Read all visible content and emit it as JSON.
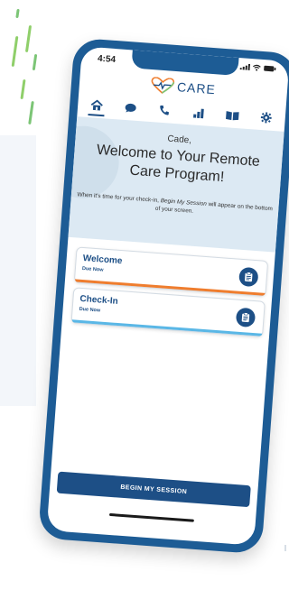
{
  "status": {
    "time": "4:54"
  },
  "app": {
    "logo_text": "CARE",
    "brand_color": "#1d4f86",
    "phone_color": "#1d5c95",
    "accent_orange": "#ef7d2e",
    "accent_blue": "#5ab7e6",
    "accent_green": "#7cc576"
  },
  "nav": {
    "items": [
      {
        "icon": "home-icon",
        "active": true
      },
      {
        "icon": "chat-icon",
        "active": false
      },
      {
        "icon": "phone-icon",
        "active": false
      },
      {
        "icon": "chart-icon",
        "active": false
      },
      {
        "icon": "book-icon",
        "active": false
      },
      {
        "icon": "gear-icon",
        "active": false
      }
    ]
  },
  "welcome": {
    "name": "Cade,",
    "title": "Welcome to Your Remote Care Program!",
    "note_before": "When it's time for your check-in, ",
    "note_em": "Begin My Session",
    "note_after": " will appear on the bottom of your screen."
  },
  "tasks": [
    {
      "title": "Welcome",
      "status": "Due Now",
      "bar_color": "#ef7d2e",
      "icon": "clipboard-icon"
    },
    {
      "title": "Check-In",
      "status": "Due Now",
      "bar_color": "#5ab7e6",
      "icon": "clipboard-icon"
    }
  ],
  "begin_button": {
    "label": "BEGIN MY SESSION"
  }
}
